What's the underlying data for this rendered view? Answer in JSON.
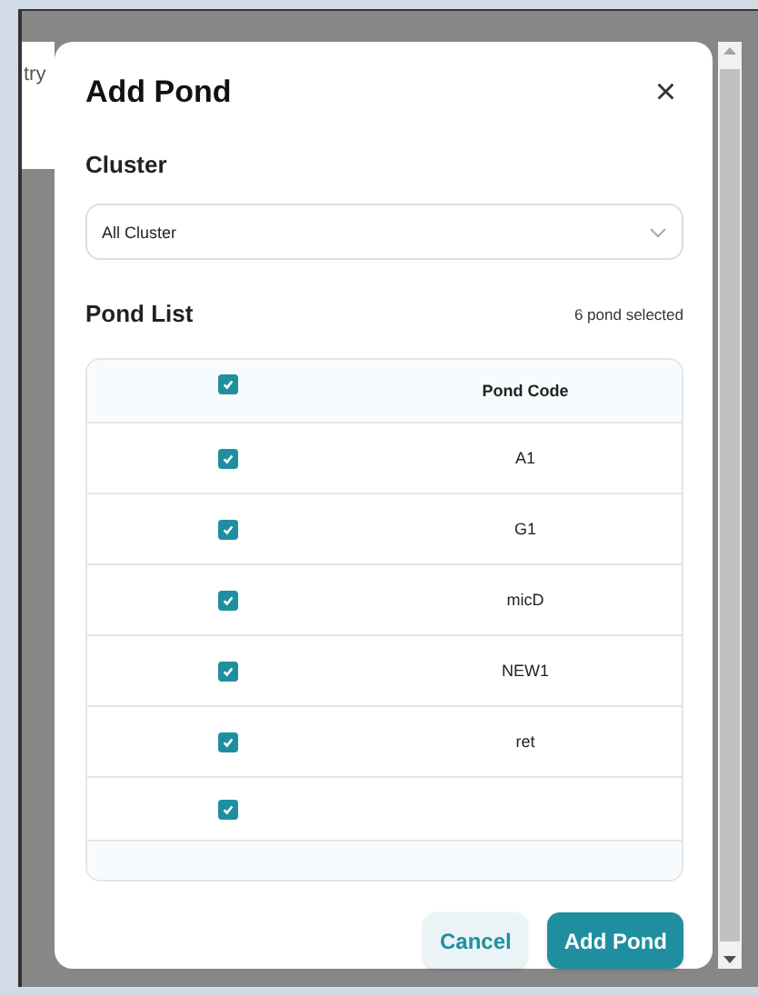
{
  "background": {
    "text": "try"
  },
  "dialog": {
    "title": "Add Pond",
    "close": "×",
    "cluster": {
      "label": "Cluster",
      "value": "All Cluster"
    },
    "pond_list": {
      "label": "Pond List",
      "count": "6 pond selected",
      "header": {
        "checked": true,
        "column": "Pond Code"
      },
      "rows": [
        {
          "checked": true,
          "code": "A1"
        },
        {
          "checked": true,
          "code": "G1"
        },
        {
          "checked": true,
          "code": "micD"
        },
        {
          "checked": true,
          "code": "NEW1"
        },
        {
          "checked": true,
          "code": "ret"
        },
        {
          "checked": true,
          "code": ""
        }
      ]
    },
    "buttons": [
      {
        "kind": "secondary",
        "label": "Cancel"
      },
      {
        "kind": "primary",
        "label": "Add Pond"
      }
    ]
  }
}
